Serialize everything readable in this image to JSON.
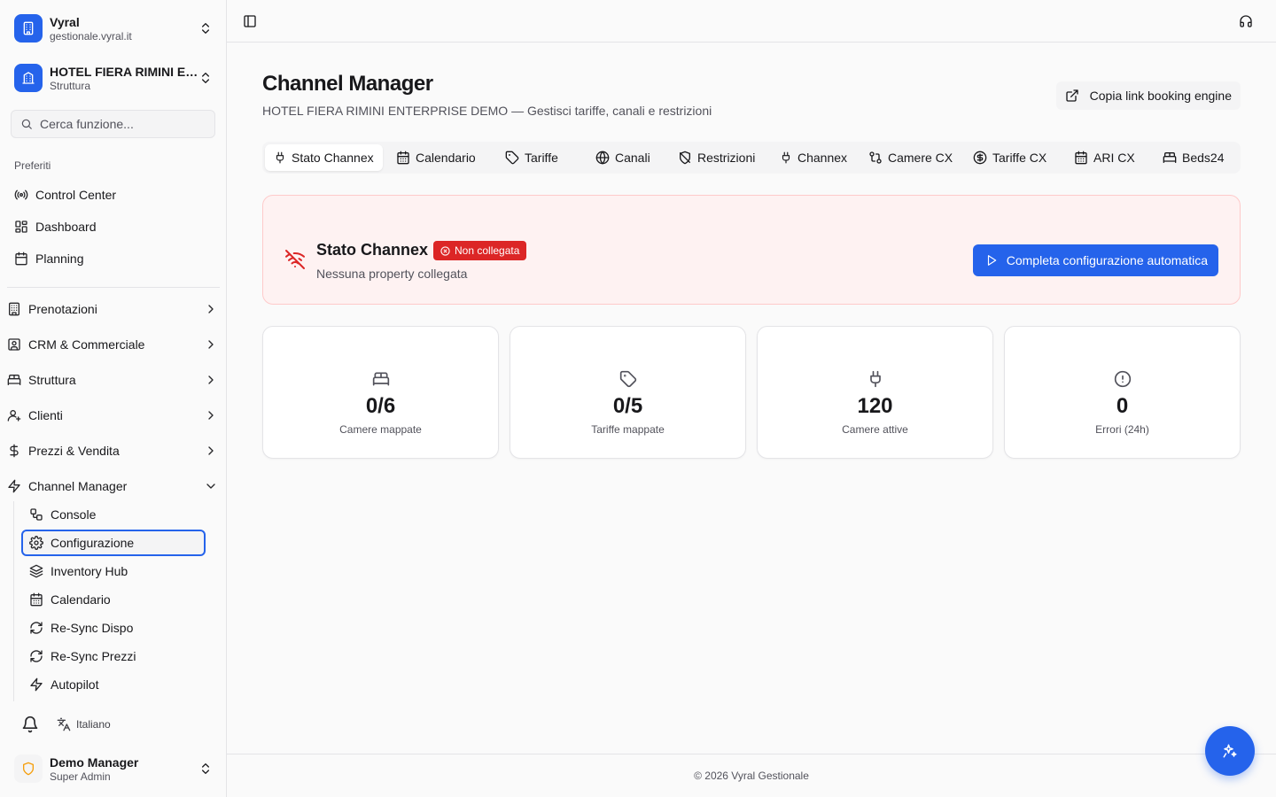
{
  "workspace": {
    "name": "Vyral",
    "domain": "gestionale.vyral.it"
  },
  "property": {
    "name": "HOTEL FIERA RIMINI ENTERPRISE DEMO",
    "type": "Struttura"
  },
  "search": {
    "placeholder": "Cerca funzione..."
  },
  "favorites": {
    "label": "Preferiti",
    "items": [
      {
        "label": "Control Center",
        "icon": "broadcast-icon"
      },
      {
        "label": "Dashboard",
        "icon": "dashboard-icon"
      },
      {
        "label": "Planning",
        "icon": "calendar-icon"
      }
    ]
  },
  "nav": {
    "items": [
      {
        "label": "Prenotazioni",
        "icon": "building-icon"
      },
      {
        "label": "CRM & Commerciale",
        "icon": "contact-icon"
      },
      {
        "label": "Struttura",
        "icon": "bed-icon"
      },
      {
        "label": "Clienti",
        "icon": "user-icon"
      },
      {
        "label": "Prezzi & Vendita",
        "icon": "dollar-icon"
      },
      {
        "label": "Channel Manager",
        "icon": "zap-icon"
      }
    ],
    "channel_manager_sub": [
      {
        "label": "Console",
        "icon": "workflow-icon"
      },
      {
        "label": "Configurazione",
        "icon": "gear-icon"
      },
      {
        "label": "Inventory Hub",
        "icon": "layers-icon"
      },
      {
        "label": "Calendario",
        "icon": "calendar-icon"
      },
      {
        "label": "Re-Sync Dispo",
        "icon": "refresh-icon"
      },
      {
        "label": "Re-Sync Prezzi",
        "icon": "refresh-icon"
      },
      {
        "label": "Autopilot",
        "icon": "zap-icon"
      }
    ]
  },
  "sidebar_footer": {
    "language": "Italiano"
  },
  "user": {
    "name": "Demo Manager",
    "role": "Super Admin"
  },
  "page": {
    "title": "Channel Manager",
    "subtitle": "HOTEL FIERA RIMINI ENTERPRISE DEMO — Gestisci tariffe, canali e restrizioni",
    "copy_link_label": "Copia link booking engine"
  },
  "tabs": [
    {
      "label": "Stato Channex",
      "icon": "plug-icon",
      "active": true
    },
    {
      "label": "Calendario",
      "icon": "calendar-icon"
    },
    {
      "label": "Tariffe",
      "icon": "tag-icon"
    },
    {
      "label": "Canali",
      "icon": "globe-icon"
    },
    {
      "label": "Restrizioni",
      "icon": "shield-off-icon"
    },
    {
      "label": "Channex",
      "icon": "plug-icon"
    },
    {
      "label": "Camere CX",
      "icon": "transfer-icon"
    },
    {
      "label": "Tariffe CX",
      "icon": "dollar-circle-icon"
    },
    {
      "label": "ARI CX",
      "icon": "calendar-grid-icon"
    },
    {
      "label": "Beds24",
      "icon": "bed-icon"
    }
  ],
  "status": {
    "title": "Stato Channex",
    "badge": "Non collegata",
    "subtitle": "Nessuna property collegata",
    "action_label": "Completa configurazione automatica",
    "colors": {
      "badge": "#dc2626",
      "background": "#fef2f2",
      "border": "#fecaca",
      "accent": "#2563eb"
    }
  },
  "stats": [
    {
      "value": "0/6",
      "label": "Camere mappate",
      "icon": "bed-icon"
    },
    {
      "value": "0/5",
      "label": "Tariffe mappate",
      "icon": "tag-icon"
    },
    {
      "value": "120",
      "label": "Camere attive",
      "icon": "plug-icon"
    },
    {
      "value": "0",
      "label": "Errori (24h)",
      "icon": "alert-circle-icon"
    }
  ],
  "footer": {
    "text": "© 2026 Vyral Gestionale"
  }
}
